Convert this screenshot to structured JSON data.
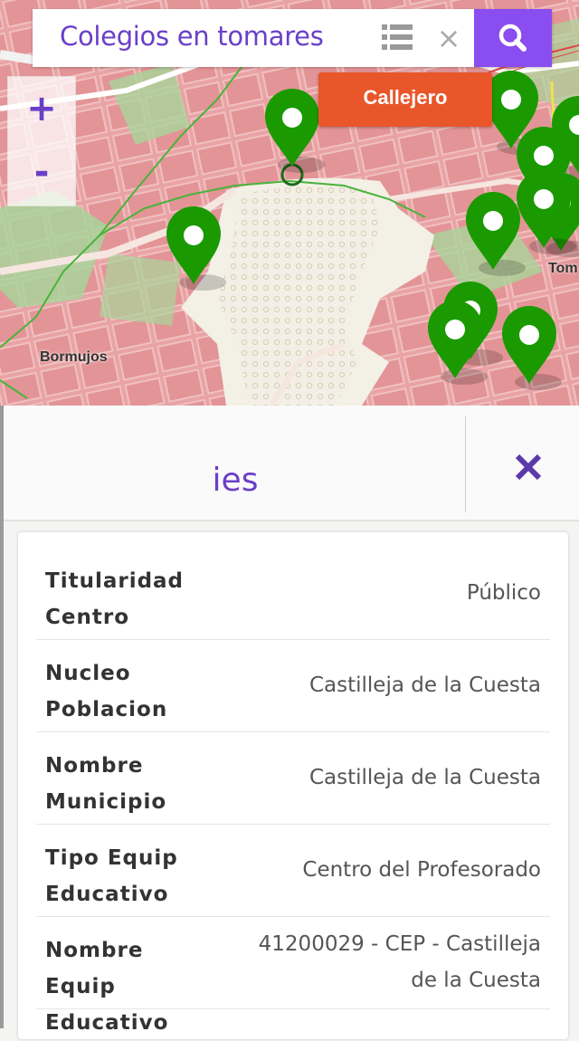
{
  "search": {
    "query": "Colegios en tomares",
    "list_icon": "list-icon",
    "clear_icon": "close-icon",
    "clear_glyph": "×",
    "search_icon": "search-icon"
  },
  "zoom": {
    "in_label": "+",
    "out_label": "-"
  },
  "map": {
    "callejero_label": "Callejero",
    "place_labels": {
      "bormujos": "Bormujos",
      "tomares": "Tom"
    },
    "marker_color": "#1a9a00"
  },
  "panel": {
    "title": "ies",
    "close_icon": "close-icon"
  },
  "details": [
    {
      "key": "Titularidad Centro",
      "value": "Público"
    },
    {
      "key": "Nucleo Poblacion",
      "value": "Castilleja de la Cuesta"
    },
    {
      "key": "Nombre Municipio",
      "value": "Castilleja de la Cuesta"
    },
    {
      "key": "Tipo Equip Educativo",
      "value": "Centro del Profesorado"
    },
    {
      "key": "Nombre Equip Educativo",
      "value": "41200029 - CEP - Castilleja de la Cuesta"
    }
  ],
  "colors": {
    "accent": "#6a3fc8",
    "search_button": "#8a4df0",
    "callejero": "#e8562a",
    "marker": "#1a9a00"
  }
}
